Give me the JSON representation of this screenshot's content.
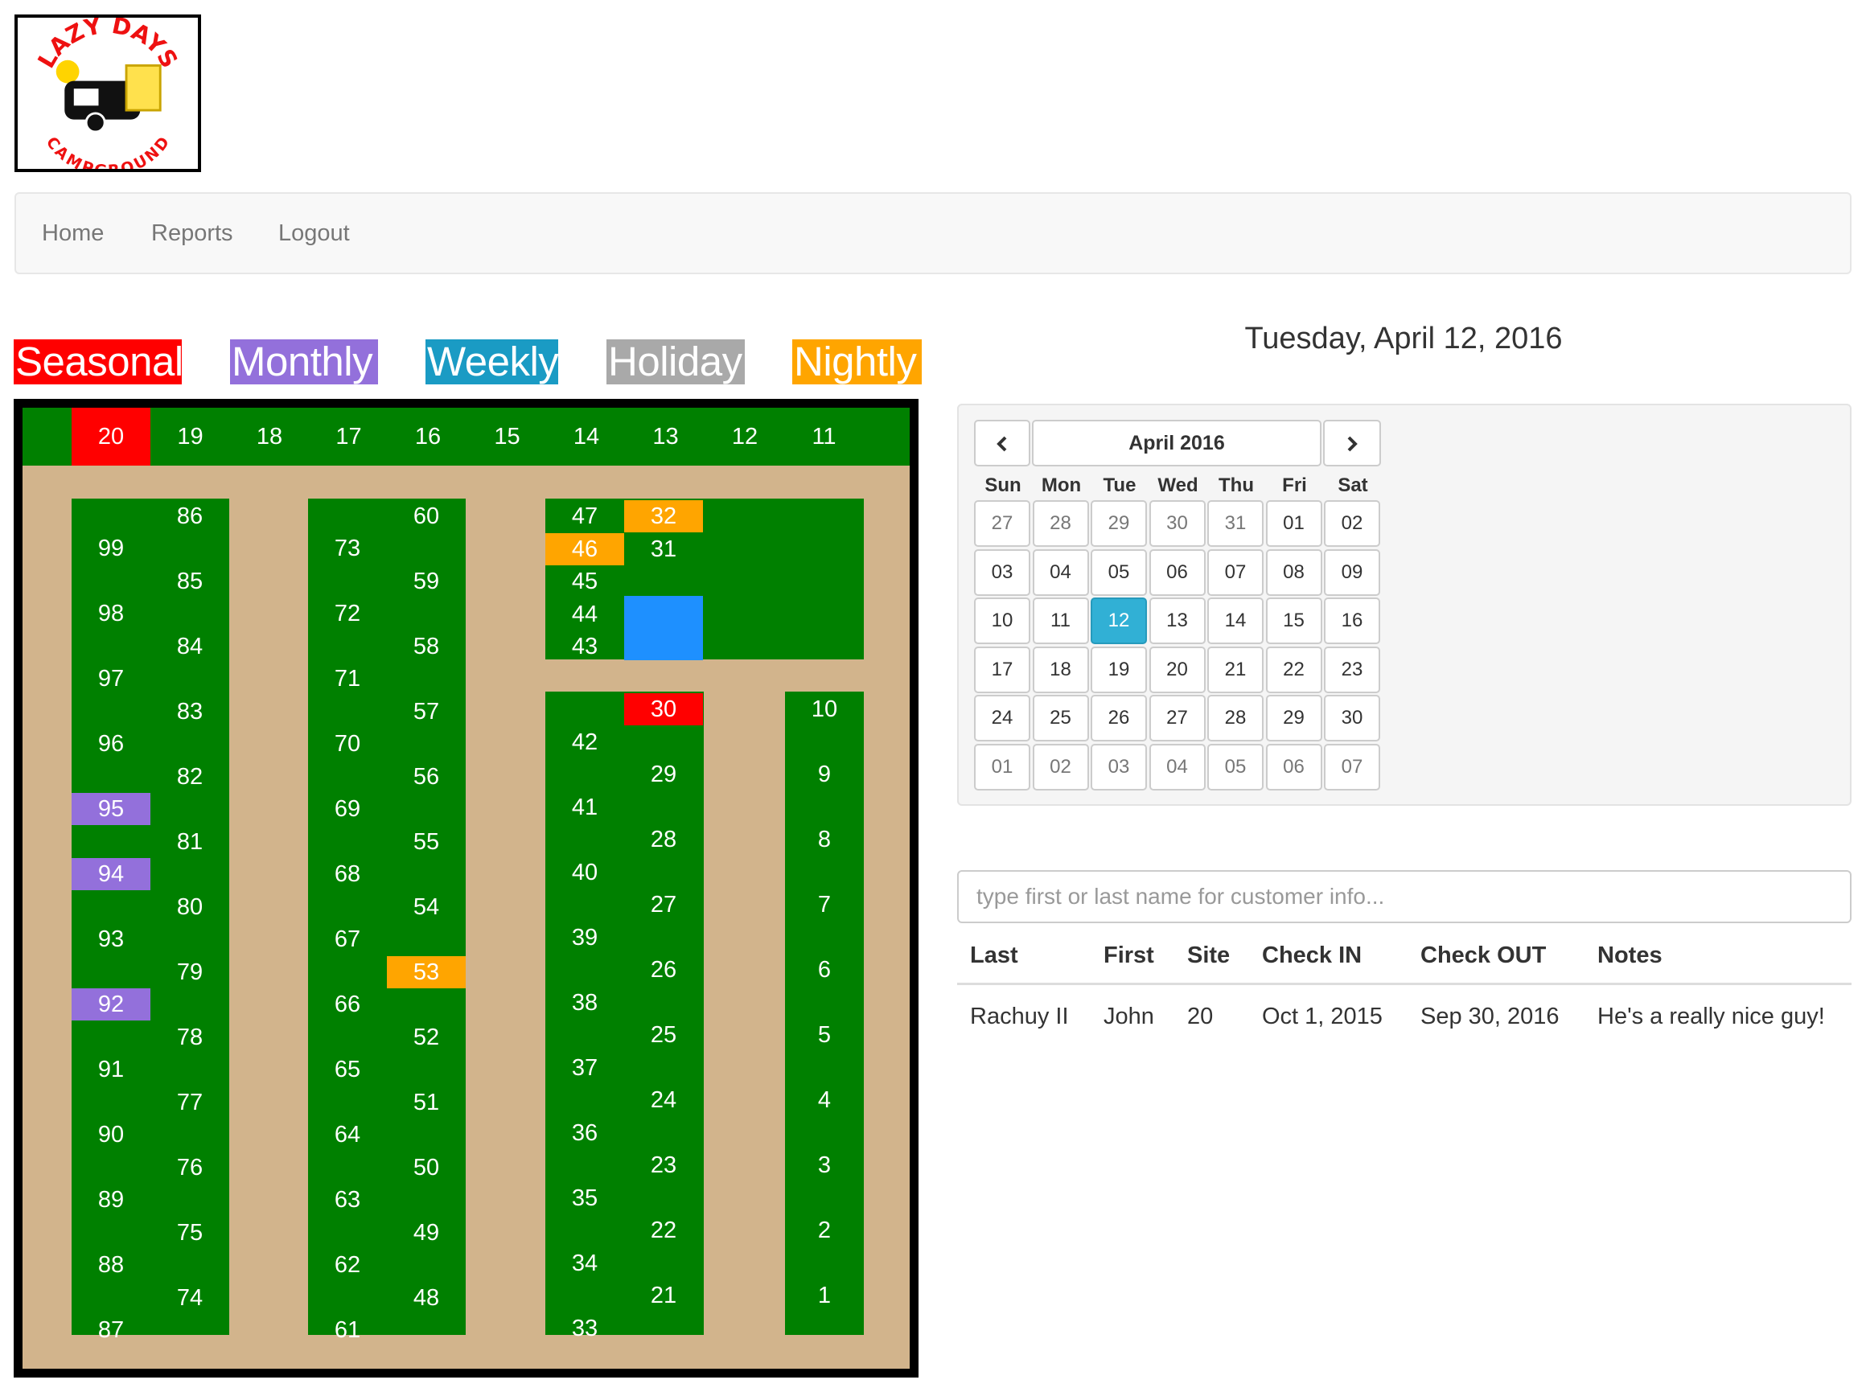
{
  "logo": {
    "top_text": "LAZY DAYS",
    "bottom_text": "CAMPGROUND"
  },
  "nav": {
    "home": "Home",
    "reports": "Reports",
    "logout": "Logout"
  },
  "legend": {
    "seasonal": "Seasonal",
    "monthly": "Monthly",
    "weekly": "Weekly",
    "holiday": "Holiday",
    "nightly": "Nightly"
  },
  "colors": {
    "seasonal": "#ff0000",
    "monthly": "#9370db",
    "weekly": "#1a9bc4",
    "holiday": "#a9a9a9",
    "nightly": "#ffa500",
    "reserved_blue": "#1e90ff",
    "grass": "#008000",
    "ground": "#d2b48c"
  },
  "map": {
    "top_row": [
      "20",
      "19",
      "18",
      "17",
      "16",
      "15",
      "14",
      "13",
      "12",
      "11"
    ],
    "col1": [
      "99",
      "98",
      "97",
      "96",
      "95",
      "94",
      "93",
      "92",
      "91",
      "90",
      "89",
      "88",
      "87"
    ],
    "col2": [
      "86",
      "85",
      "84",
      "83",
      "82",
      "81",
      "80",
      "79",
      "78",
      "77",
      "76",
      "75",
      "74"
    ],
    "col3": [
      "73",
      "72",
      "71",
      "70",
      "69",
      "68",
      "67",
      "66",
      "65",
      "64",
      "63",
      "62",
      "61"
    ],
    "col4": [
      "60",
      "59",
      "58",
      "57",
      "56",
      "55",
      "54",
      "53",
      "52",
      "51",
      "50",
      "49",
      "48"
    ],
    "col5_upper": [
      "47",
      "46",
      "45",
      "44",
      "43"
    ],
    "col6_upper": [
      "32",
      "31"
    ],
    "col5_lower": [
      "42",
      "41",
      "40",
      "39",
      "38",
      "37",
      "36",
      "35",
      "34",
      "33"
    ],
    "col6_lower": [
      "30",
      "29",
      "28",
      "27",
      "26",
      "25",
      "24",
      "23",
      "22",
      "21"
    ],
    "col7": [
      "10",
      "9",
      "8",
      "7",
      "6",
      "5",
      "4",
      "3",
      "2",
      "1"
    ],
    "site_status": {
      "20": "seasonal",
      "30": "seasonal",
      "95": "monthly",
      "94": "monthly",
      "92": "monthly",
      "53": "nightly",
      "32": "nightly",
      "46": "nightly"
    }
  },
  "date_title": "Tuesday, April 12, 2016",
  "calendar": {
    "title": "April 2016",
    "prev_icon": "chevron-left-icon",
    "next_icon": "chevron-right-icon",
    "weekdays": [
      "Sun",
      "Mon",
      "Tue",
      "Wed",
      "Thu",
      "Fri",
      "Sat"
    ],
    "weeks": [
      [
        "27",
        "28",
        "29",
        "30",
        "31",
        "01",
        "02"
      ],
      [
        "03",
        "04",
        "05",
        "06",
        "07",
        "08",
        "09"
      ],
      [
        "10",
        "11",
        "12",
        "13",
        "14",
        "15",
        "16"
      ],
      [
        "17",
        "18",
        "19",
        "20",
        "21",
        "22",
        "23"
      ],
      [
        "24",
        "25",
        "26",
        "27",
        "28",
        "29",
        "30"
      ],
      [
        "01",
        "02",
        "03",
        "04",
        "05",
        "06",
        "07"
      ]
    ],
    "selected": "12"
  },
  "search": {
    "placeholder": "type first or last name for customer info...",
    "value": ""
  },
  "results": {
    "columns": [
      "Last",
      "First",
      "Site",
      "Check IN",
      "Check OUT",
      "Notes"
    ],
    "rows": [
      [
        "Rachuy II",
        "John",
        "20",
        "Oct 1, 2015",
        "Sep 30, 2016",
        "He's a really nice guy!"
      ]
    ]
  }
}
